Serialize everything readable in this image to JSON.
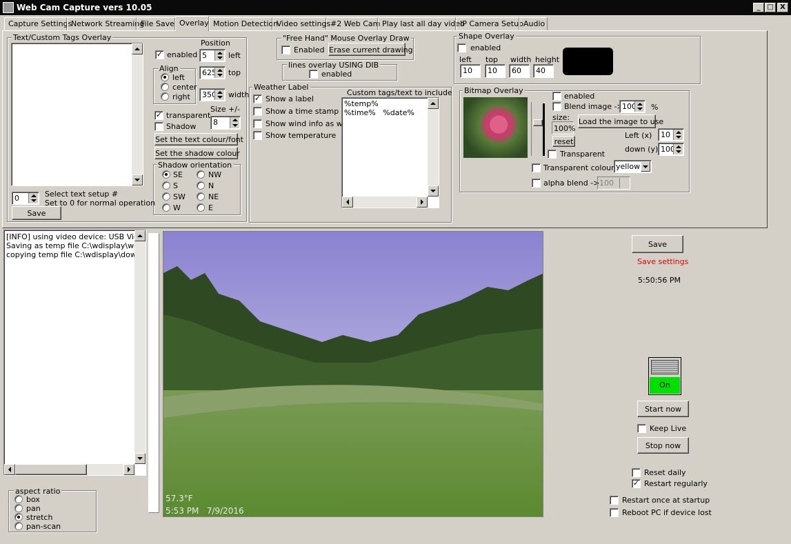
{
  "window": {
    "title": "Web Cam Capture vers 10.05",
    "min": "_",
    "max": "□",
    "close": "X"
  },
  "tabs": [
    "Capture Settings",
    "Network Streaming",
    "File Save",
    "Overlay",
    "Motion Detection",
    "Video settings",
    "#2 Web Cam",
    "Play last all day video",
    "IP Camera Setup",
    "Audio"
  ],
  "text_overlay": {
    "group": "Text/Custom Tags Overlay",
    "position_label": "Position",
    "enabled": "enabled",
    "left_val": "5",
    "left": "left",
    "top_val": "625",
    "top": "top",
    "width_val": "350",
    "width": "width",
    "align_group": "Align",
    "align_left": "left",
    "align_center": "center",
    "align_right": "right",
    "transparent": "transparent",
    "shadow": "Shadow",
    "size_label": "Size +/-",
    "size_val": "8",
    "set_text_colour": "Set the text colour/font",
    "set_shadow_colour": "Set the shadow colour",
    "shadow_orientation": "Shadow orientation",
    "orient": [
      "SE",
      "NW",
      "S",
      "N",
      "SW",
      "NE",
      "W",
      "E"
    ],
    "setup_val": "0",
    "select_setup": "Select text setup #",
    "set_zero": "Set to 0 for normal operation",
    "save": "Save"
  },
  "freehand": {
    "group": "\"Free Hand\" Mouse Overlay Draw",
    "enabled": "Enabled",
    "erase": "Erase current drawing"
  },
  "lines": {
    "group": "lines overlay USING DIB",
    "enabled": "enabled"
  },
  "weather": {
    "group": "Weather Label",
    "show_label": "Show a label",
    "time_stamp": "Show a time stamp",
    "wind": "Show wind info as well",
    "temperature": "Show temperature"
  },
  "custom_tags": {
    "label": "Custom tags/text to include",
    "line1": "%temp%",
    "line2": "%time%   %date%"
  },
  "shape": {
    "group": "Shape Overlay",
    "enabled": "enabled",
    "left": "left",
    "top": "top",
    "width": "width",
    "height": "height",
    "left_val": "10",
    "top_val": "10",
    "width_val": "60",
    "height_val": "40",
    "color": "#000000"
  },
  "bitmap": {
    "group": "Bitmap Overlay",
    "enabled": "enabled",
    "blend": "Blend image ->",
    "blend_val": "100",
    "pct": "%",
    "size": "size:",
    "size_val": "100%",
    "reset": "reset",
    "load": "Load the image to use",
    "left_x": "Left (x)",
    "left_x_val": "10",
    "down_y": "down (y)",
    "down_y_val": "100",
    "transparent": "Transparent",
    "transparent_colour": "Transparent colour -",
    "colour_val": "yellow",
    "alpha_blend": "alpha blend ->",
    "alpha_val": "100"
  },
  "log": [
    "[INFO] using video device: USB Video",
    "Saving as temp file C:\\wdisplay\\webfi",
    "copying temp file C:\\wdisplay\\downlo"
  ],
  "aspect": {
    "group": "aspect ratio",
    "options": [
      "box",
      "pan",
      "stretch",
      "pan-scan"
    ]
  },
  "preview": {
    "temp": "57.3°F",
    "stamp": "5:53 PM   7/9/2016"
  },
  "right": {
    "save": "Save",
    "save_settings": "Save settings",
    "time": "5:50:56 PM",
    "on": "On",
    "start_now": "Start now",
    "keep_live": "Keep Live",
    "stop_now": "Stop now",
    "reset_daily": "Reset daily",
    "restart_regularly": "Restart regularly",
    "restart_startup": "Restart once at startup",
    "reboot": "Reboot PC if device lost"
  }
}
